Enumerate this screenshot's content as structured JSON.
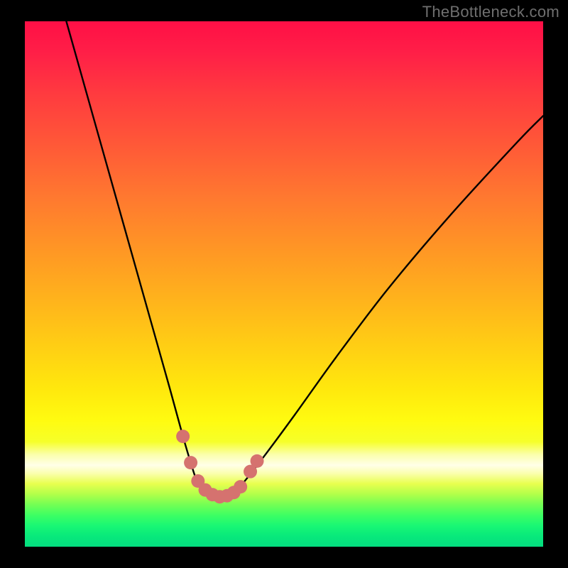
{
  "watermark": "TheBottleneck.com",
  "chart_data": {
    "type": "line",
    "title": "",
    "xlabel": "",
    "ylabel": "",
    "xlim": [
      0,
      100
    ],
    "ylim": [
      0,
      100
    ],
    "grid": false,
    "series": [
      {
        "name": "bottleneck-curve",
        "x": [
          8,
          12,
          16,
          20,
          24,
          28,
          30.5,
          32,
          33,
          34,
          35,
          36,
          37.5,
          39,
          40,
          42,
          46,
          52,
          60,
          70,
          82,
          95,
          100
        ],
        "values": [
          100,
          86,
          72,
          58,
          44,
          30,
          21,
          16,
          13,
          11.2,
          10.3,
          9.8,
          9.5,
          9.7,
          10.2,
          12,
          17,
          25,
          36,
          49,
          63,
          77,
          82
        ]
      }
    ],
    "markers": {
      "name": "highlight-dots",
      "color": "#d5726f",
      "x": [
        30.5,
        32.0,
        33.4,
        34.8,
        36.2,
        37.6,
        39.0,
        40.3,
        41.6,
        43.5,
        44.8
      ],
      "values": [
        21.0,
        16.0,
        12.5,
        10.8,
        9.9,
        9.5,
        9.7,
        10.3,
        11.4,
        14.3,
        16.3
      ]
    },
    "background_gradient": {
      "top": "#ff0f46",
      "mid_upper": "#ffb61b",
      "mid": "#fffb10",
      "pale_band": "#ffffe8",
      "lower": "#19f774",
      "bottom": "#04dd80"
    }
  }
}
